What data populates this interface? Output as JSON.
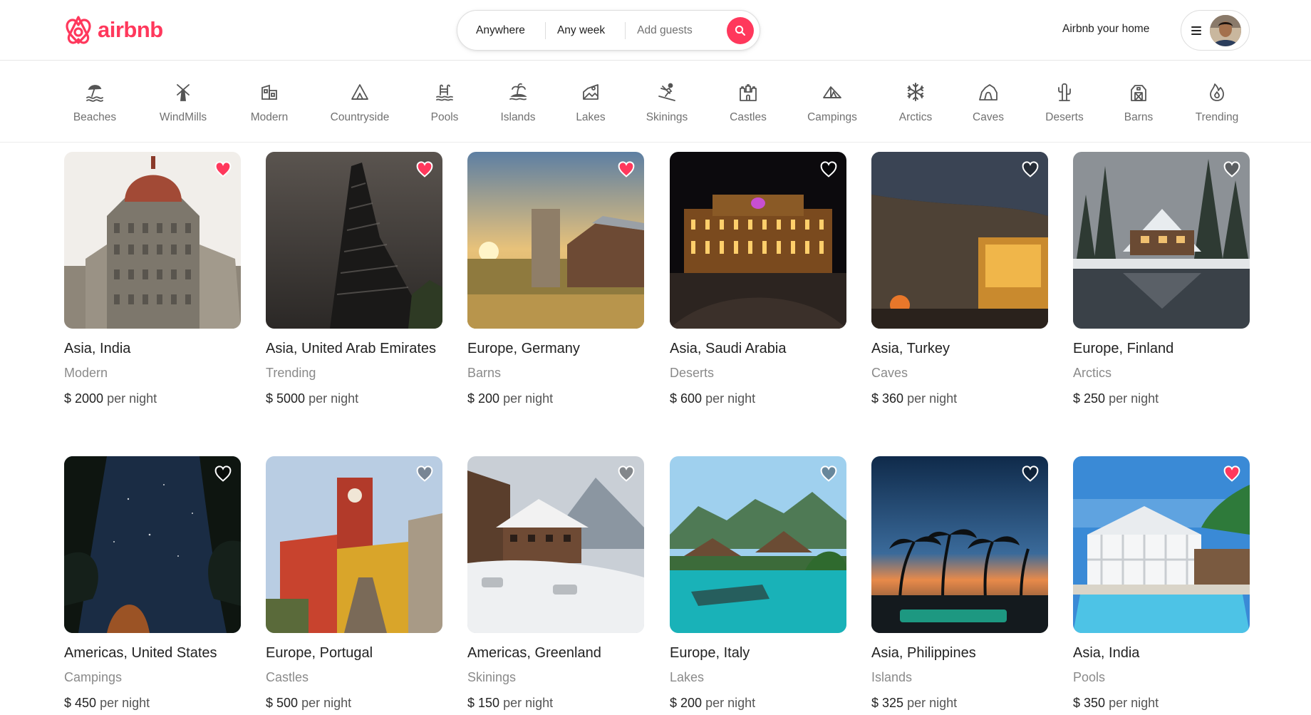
{
  "brand": {
    "name": "airbnb",
    "color": "#ff385c"
  },
  "search": {
    "where": "Anywhere",
    "when": "Any week",
    "who": "Add guests",
    "button_icon": "search-icon"
  },
  "header": {
    "host_link": "Airbnb your home",
    "menu_icon": "menu-icon"
  },
  "categories": [
    {
      "label": "Beaches",
      "icon": "beach-icon"
    },
    {
      "label": "WindMills",
      "icon": "windmill-icon"
    },
    {
      "label": "Modern",
      "icon": "modern-house-icon"
    },
    {
      "label": "Countryside",
      "icon": "countryside-icon"
    },
    {
      "label": "Pools",
      "icon": "pool-icon"
    },
    {
      "label": "Islands",
      "icon": "island-icon"
    },
    {
      "label": "Lakes",
      "icon": "lake-icon"
    },
    {
      "label": "Skinings",
      "icon": "skiing-icon"
    },
    {
      "label": "Castles",
      "icon": "castle-icon"
    },
    {
      "label": "Campings",
      "icon": "camping-icon"
    },
    {
      "label": "Arctics",
      "icon": "snowflake-icon"
    },
    {
      "label": "Caves",
      "icon": "cave-icon"
    },
    {
      "label": "Deserts",
      "icon": "cactus-icon"
    },
    {
      "label": "Barns",
      "icon": "barn-icon"
    },
    {
      "label": "Trending",
      "icon": "flame-icon"
    }
  ],
  "price_unit": "per night",
  "listings": [
    {
      "location": "Asia, India",
      "category": "Modern",
      "price": "$ 2000",
      "favorited": true
    },
    {
      "location": "Asia, United Arab Emirates",
      "category": "Trending",
      "price": "$ 5000",
      "favorited": true
    },
    {
      "location": "Europe, Germany",
      "category": "Barns",
      "price": "$ 200",
      "favorited": true
    },
    {
      "location": "Asia, Saudi Arabia",
      "category": "Deserts",
      "price": "$ 600",
      "favorited": false
    },
    {
      "location": "Asia, Turkey",
      "category": "Caves",
      "price": "$ 360",
      "favorited": false
    },
    {
      "location": "Europe, Finland",
      "category": "Arctics",
      "price": "$ 250",
      "favorited": false
    },
    {
      "location": "Americas, United States",
      "category": "Campings",
      "price": "$ 450",
      "favorited": false
    },
    {
      "location": "Europe, Portugal",
      "category": "Castles",
      "price": "$ 500",
      "favorited": false
    },
    {
      "location": "Americas, Greenland",
      "category": "Skinings",
      "price": "$ 150",
      "favorited": false
    },
    {
      "location": "Europe, Italy",
      "category": "Lakes",
      "price": "$ 200",
      "favorited": false
    },
    {
      "location": "Asia, Philippines",
      "category": "Islands",
      "price": "$ 325",
      "favorited": false
    },
    {
      "location": "Asia, India",
      "category": "Pools",
      "price": "$ 350",
      "favorited": true
    }
  ]
}
